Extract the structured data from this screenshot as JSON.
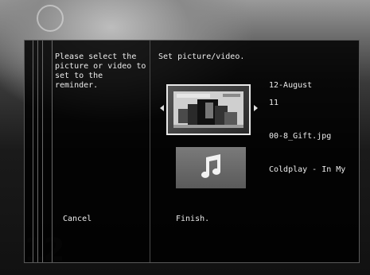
{
  "dialog": {
    "prompt": "Please select the\npicture or video to\nset to the reminder.",
    "heading": "Set picture/video.",
    "date_line1": "12-August",
    "date_line2": "11",
    "filename": "00-8_Gift.jpg",
    "music_title": "Coldplay - In My",
    "cancel_label": "Cancel",
    "finish_label": "Finish."
  },
  "icons": {
    "clock": "clock-icon",
    "arrow_left": "arrow-left-icon",
    "arrow_right": "arrow-right-icon",
    "music": "music-note-icon"
  },
  "colors": {
    "text": "#ececec",
    "panel": "#000000",
    "border": "#5a5a5a"
  }
}
